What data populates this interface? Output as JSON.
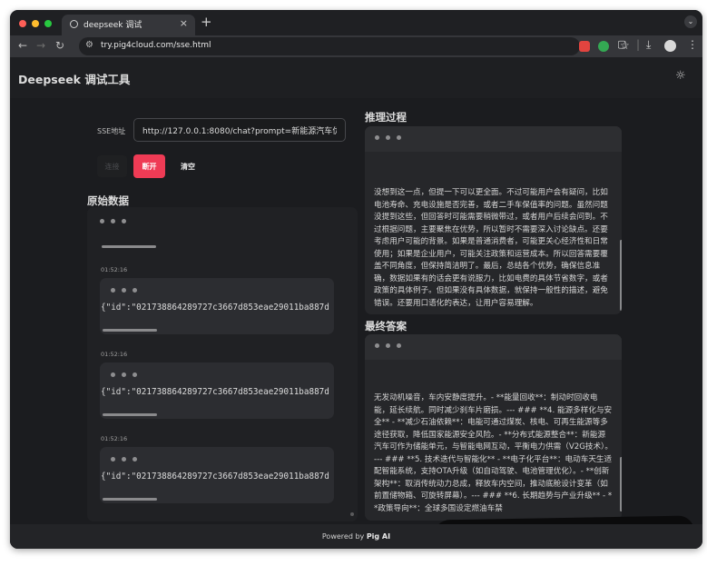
{
  "browser": {
    "tab_title": "deepseek 调试",
    "tab_close": "×",
    "new_tab": "+",
    "url": "try.pig4cloud.com/sse.html",
    "icons": [
      "back-icon",
      "forward-icon",
      "reload-icon",
      "site-info-icon",
      "bookmark-star-icon",
      "download-icon",
      "profile-icon",
      "menu-icon"
    ],
    "traffic_colors": {
      "close": "#ff5f57",
      "minimize": "#febc2e",
      "maximize": "#28c840"
    }
  },
  "app": {
    "title": "Deepseek 调试工具",
    "theme_toggle": "☼",
    "sse_label": "SSE地址",
    "sse_value": "http://127.0.0.1:8080/chat?prompt=新能源汽车优势",
    "buttons": {
      "connect": "连接",
      "disconnect": "断开",
      "clear": "清空"
    },
    "accent": "#ef3b55"
  },
  "raw_data": {
    "title": "原始数据",
    "entries": [
      {
        "time": "01:52:16",
        "content": "{\"id\":\"021738864289727c3667d853eae29011ba887d"
      },
      {
        "time": "01:52:16",
        "content": "{\"id\":\"021738864289727c3667d853eae29011ba887d"
      },
      {
        "time": "01:52:16",
        "content": "{\"id\":\"021738864289727c3667d853eae29011ba887d"
      }
    ]
  },
  "reasoning": {
    "title": "推理过程",
    "text": "没想到这一点，但提一下可以更全面。不过可能用户会有疑问，比如电池寿命、充电设施是否完善，或者二手车保值率的问题。虽然问题没提到这些，但回答时可能需要稍微带过，或者用户后续会问到。不过根据问题，主要聚焦在优势，所以暂时不需要深入讨论缺点。还要考虑用户可能的背景。如果是普通消费者，可能更关心经济性和日常使用；如果是企业用户，可能关注政策和运营成本。所以回答需要覆盖不同角度，但保持简洁明了。最后，总结各个优势，确保信息准确，数据如果有的话会更有说服力，比如电费的具体节省数字，或者政策的具体例子。但如果没有具体数据，就保持一般性的描述，避免错误。还要用口语化的表达，让用户容易理解。"
  },
  "answer": {
    "title": "最终答案",
    "text": "无发动机噪音，车内安静度提升。- **能量回收**：制动时回收电能，延长续航。同时减少刹车片磨损。--- ### **4. 能源多样化与安全** - **减少石油依赖**：电能可通过煤炭、核电、可再生能源等多途径获取，降低国家能源安全风险。- **分布式能源整合**：新能源汽车可作为储能单元，与智能电网互动，平衡电力供需（V2G技术）。--- ### **5. 技术迭代与智能化** - **电子化平台**：电动车天生适配智能系统，支持OTA升级（如自动驾驶、电池管理优化）。- **创新架构**：取消传统动力总成，释放车内空间，推动底舱设计变革（如前置储物箱、可旋转屏幕）。--- ### **6. 长期趋势与产业升级** - **政策导向**：全球多国设定燃油车禁"
  },
  "footer": {
    "prefix": "Powered by",
    "brand": "Pig AI"
  }
}
